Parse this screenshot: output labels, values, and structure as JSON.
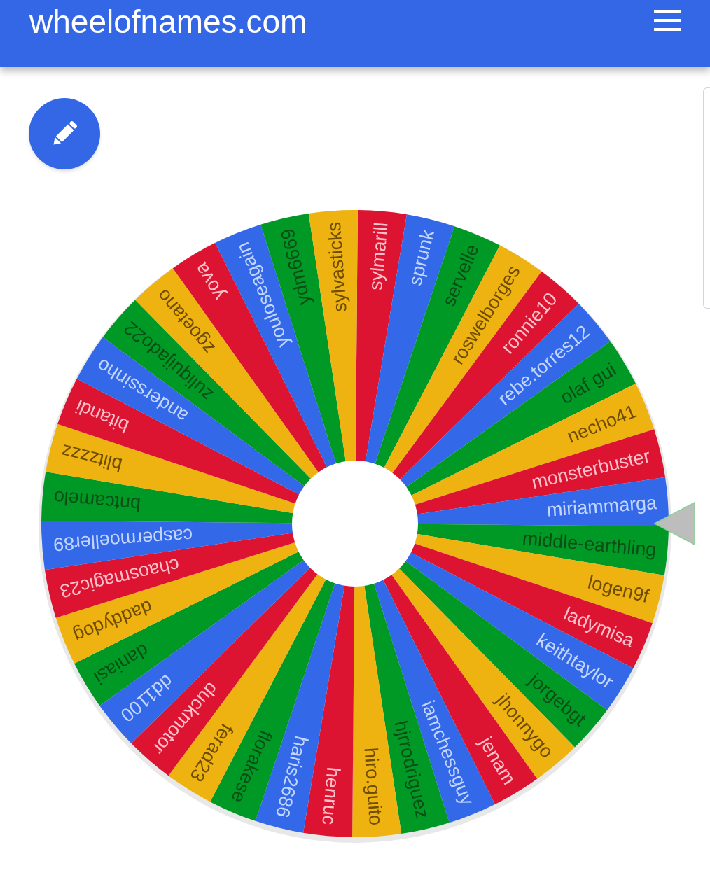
{
  "header": {
    "title": "wheelofnames.com"
  },
  "wheel": {
    "segments": [
      {
        "name": "sylmarill",
        "color": "#dc1431"
      },
      {
        "name": "sprunk",
        "color": "#3369e8"
      },
      {
        "name": "servelle",
        "color": "#009925"
      },
      {
        "name": "roswelborges",
        "color": "#eeb211"
      },
      {
        "name": "ronnie10",
        "color": "#dc1431"
      },
      {
        "name": "rebe.torres12",
        "color": "#3369e8"
      },
      {
        "name": "olaf gui",
        "color": "#009925"
      },
      {
        "name": "necho41",
        "color": "#eeb211"
      },
      {
        "name": "monsterbuster",
        "color": "#dc1431"
      },
      {
        "name": "miriammarga",
        "color": "#3369e8"
      },
      {
        "name": "middle-earthling",
        "color": "#009925"
      },
      {
        "name": "logen9f",
        "color": "#eeb211"
      },
      {
        "name": "ladymisa",
        "color": "#dc1431"
      },
      {
        "name": "keithtaylor",
        "color": "#3369e8"
      },
      {
        "name": "jorgebgt",
        "color": "#009925"
      },
      {
        "name": "jhonnygo",
        "color": "#eeb211"
      },
      {
        "name": "jenam",
        "color": "#dc1431"
      },
      {
        "name": "iamchessguy",
        "color": "#3369e8"
      },
      {
        "name": "hjrrodriguez",
        "color": "#009925"
      },
      {
        "name": "hiro.guito",
        "color": "#eeb211"
      },
      {
        "name": "henruc",
        "color": "#dc1431"
      },
      {
        "name": "haris2686",
        "color": "#3369e8"
      },
      {
        "name": "florakese",
        "color": "#009925"
      },
      {
        "name": "ferad23",
        "color": "#eeb211"
      },
      {
        "name": "duckmotor",
        "color": "#dc1431"
      },
      {
        "name": "dd1100",
        "color": "#3369e8"
      },
      {
        "name": "daniasi",
        "color": "#009925"
      },
      {
        "name": "daddydog",
        "color": "#eeb211"
      },
      {
        "name": "chaosmagic23",
        "color": "#dc1431"
      },
      {
        "name": "caspermoeller89",
        "color": "#3369e8"
      },
      {
        "name": "bntcamelo",
        "color": "#009925"
      },
      {
        "name": "blitzzzz",
        "color": "#eeb211"
      },
      {
        "name": "bitandi",
        "color": "#dc1431"
      },
      {
        "name": "anderssinho",
        "color": "#3369e8"
      },
      {
        "name": "zuliquijado22",
        "color": "#009925"
      },
      {
        "name": "zgoetano",
        "color": "#eeb211"
      },
      {
        "name": "yova",
        "color": "#dc1431"
      },
      {
        "name": "youloseagain",
        "color": "#3369e8"
      },
      {
        "name": "ydm6669",
        "color": "#009925"
      },
      {
        "name": "sylvasticks",
        "color": "#eeb211"
      }
    ]
  }
}
